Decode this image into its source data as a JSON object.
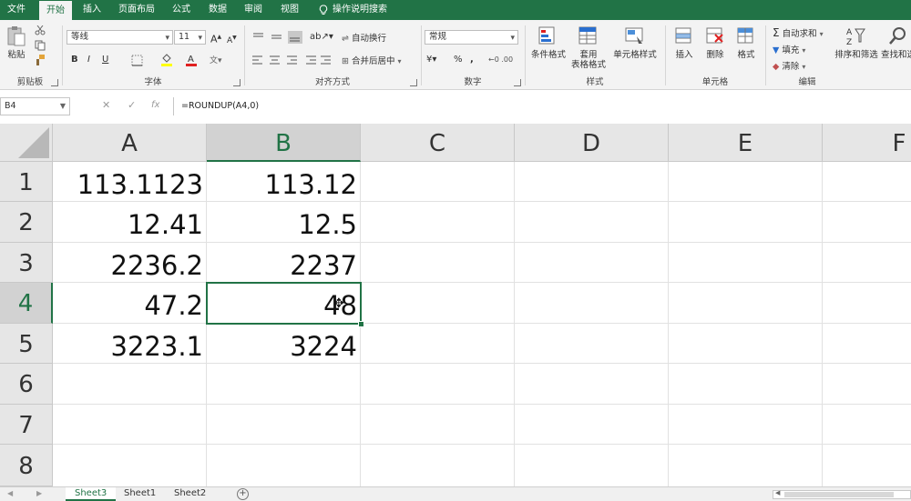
{
  "colors": {
    "accent": "#217346",
    "ribbon_bg": "#f3f3f3",
    "header_bg": "#e6e6e6"
  },
  "ribbon_tabs": [
    "文件",
    "开始",
    "插入",
    "页面布局",
    "公式",
    "数据",
    "审阅",
    "视图",
    "操作说明搜索"
  ],
  "active_tab": "开始",
  "clipboard": {
    "paste_label": "粘贴",
    "group_label": "剪贴板"
  },
  "font": {
    "name": "等线",
    "size": "11",
    "grow": "A",
    "shrink": "A",
    "bold": "B",
    "italic": "I",
    "underline": "U",
    "group_label": "字体"
  },
  "alignment": {
    "wrap_label": "自动换行",
    "merge_label": "合并后居中",
    "group_label": "对齐方式"
  },
  "number": {
    "format": "常规",
    "currency": "¥",
    "percent": "%",
    "comma": ",",
    "group_label": "数字"
  },
  "styles": {
    "conditional": "条件格式",
    "table_line1": "套用",
    "table_line2": "表格格式",
    "cell_styles": "单元格样式",
    "group_label": "样式"
  },
  "cells_group": {
    "insert": "插入",
    "delete": "删除",
    "format": "格式",
    "group_label": "单元格"
  },
  "editing": {
    "autosum": "自动求和",
    "fill": "填充",
    "clear": "清除",
    "sort_filter": "排序和筛选",
    "find_select": "查找和选",
    "group_label": "编辑"
  },
  "formula_bar": {
    "name_box": "B4",
    "fx": "fx",
    "formula": "=ROUNDUP(A4,0)"
  },
  "columns": [
    "A",
    "B",
    "C",
    "D",
    "E",
    "F"
  ],
  "rows": [
    "1",
    "2",
    "3",
    "4",
    "5",
    "6",
    "7",
    "8"
  ],
  "cells": {
    "A": [
      "113.1123",
      "12.41",
      "2236.2",
      "47.2",
      "3223.1"
    ],
    "B": [
      "113.12",
      "12.5",
      "2237",
      "48",
      "3224"
    ]
  },
  "selected_cell": "B4",
  "sheets": [
    "Sheet3",
    "Sheet1",
    "Sheet2"
  ],
  "active_sheet": "Sheet3"
}
